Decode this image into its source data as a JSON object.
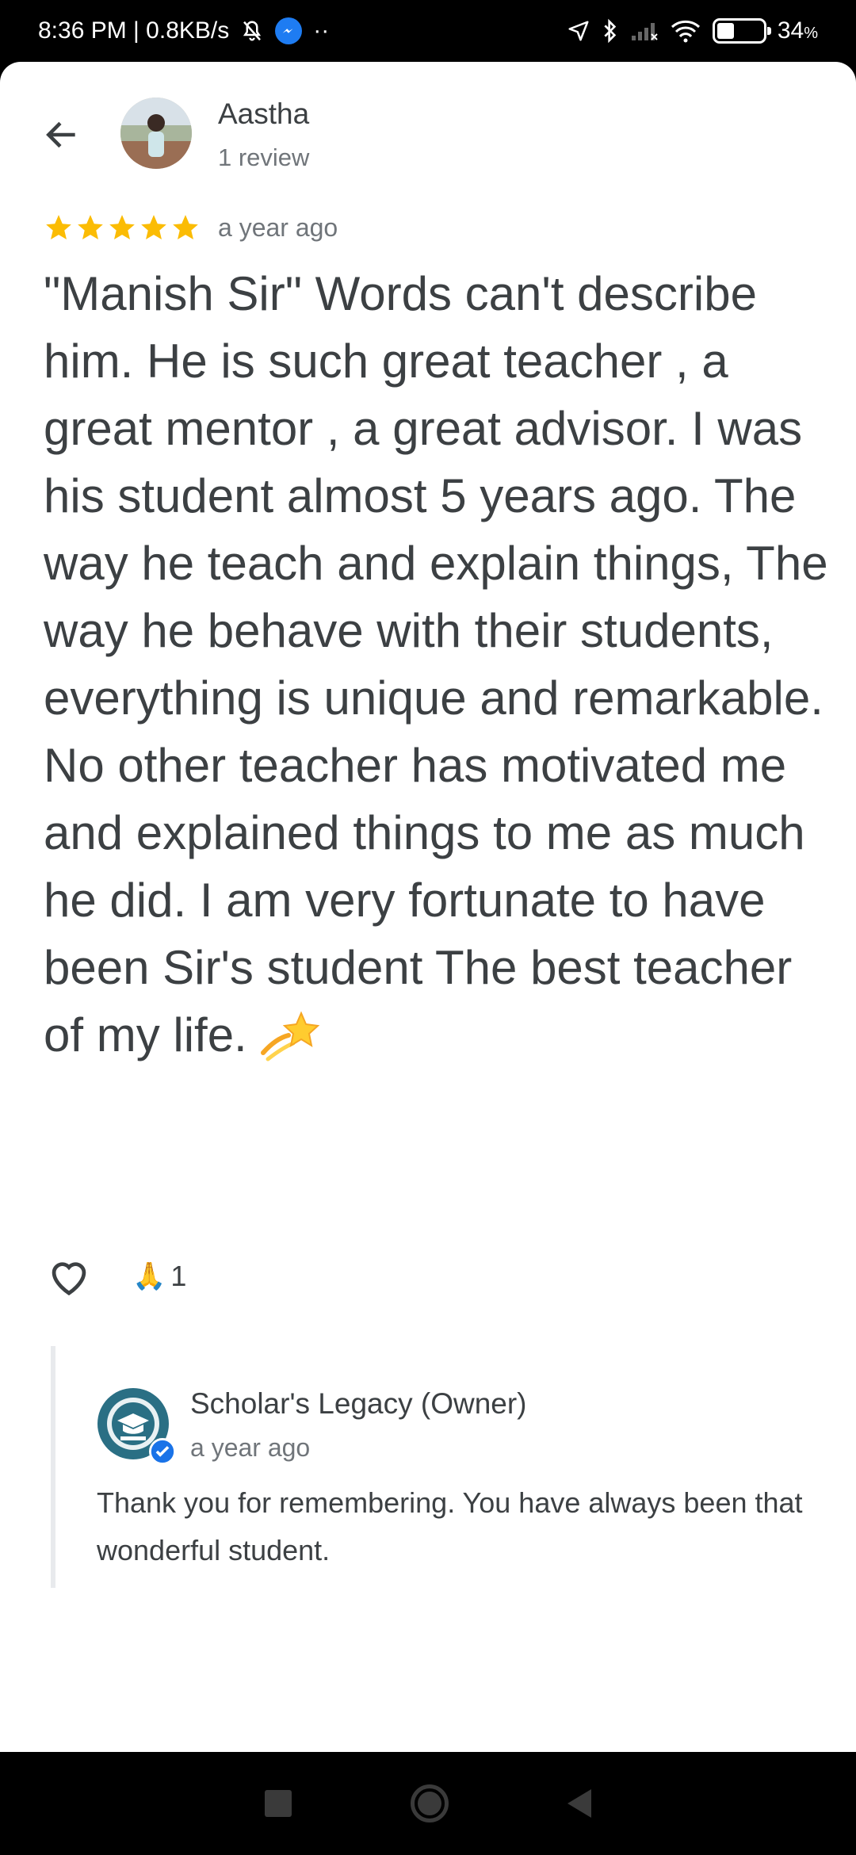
{
  "status_bar": {
    "time_speed": "8:36 PM | 0.8KB/s",
    "overflow_dots": "··",
    "battery_percent": "34",
    "battery_unit": "%"
  },
  "review": {
    "author_name": "Aastha",
    "author_meta": "1 review",
    "rating": 5,
    "time": "a year ago",
    "text": "\"Manish Sir\" Words can't describe him. He is such great teacher , a great mentor , a great advisor. I was his student almost 5 years ago. The way he teach and explain things,  The way he behave with their students, everything is unique and remarkable. No other teacher has motivated me and explained things to me as much he did. I am very fortunate to have been Sir's student The best teacher of my life.",
    "emoji": "sparkles-star-icon",
    "reaction_emoji": "🙏",
    "reaction_count": "1"
  },
  "owner_reply": {
    "name": "Scholar's Legacy (Owner)",
    "time": "a year ago",
    "text": "Thank you for remembering. You have always been that wonderful student."
  },
  "colors": {
    "star": "#fbbc04",
    "text_primary": "#3c4043",
    "text_secondary": "#70757a",
    "verified_blue": "#1a73e8",
    "owner_logo": "#2a6f84"
  }
}
